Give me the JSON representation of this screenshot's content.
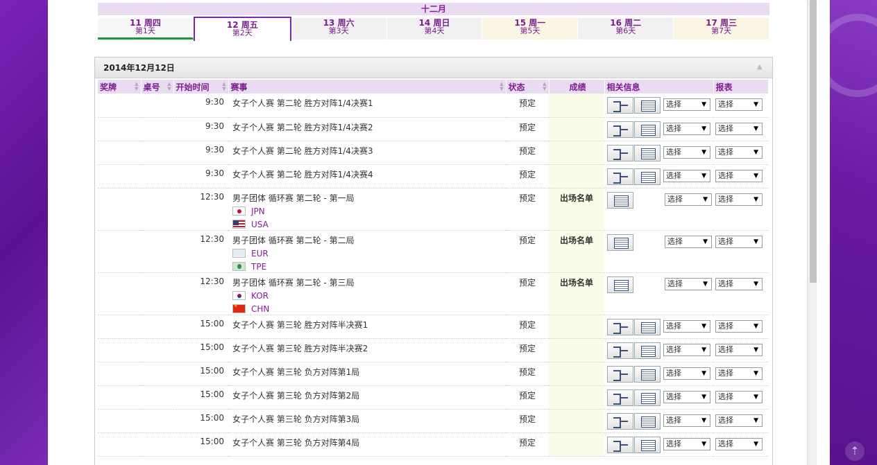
{
  "month": "十二月",
  "days": [
    {
      "d1": "11 周四",
      "d2": "第1天",
      "state": "past"
    },
    {
      "d1": "12 周五",
      "d2": "第2天",
      "state": "active"
    },
    {
      "d1": "13 周六",
      "d2": "第3天",
      "state": "normal"
    },
    {
      "d1": "14 周日",
      "d2": "第4天",
      "state": "normal"
    },
    {
      "d1": "15 周一",
      "d2": "第5天",
      "state": "weekend"
    },
    {
      "d1": "16 周二",
      "d2": "第6天",
      "state": "normal"
    },
    {
      "d1": "17 周三",
      "d2": "第7天",
      "state": "weekend"
    }
  ],
  "panel_title": "2014年12月12日",
  "columns": {
    "medal": "奖牌",
    "table": "桌号",
    "start": "开始时间",
    "event": "赛事",
    "status": "状态",
    "result": "成绩",
    "info": "相关信息",
    "report": "报表"
  },
  "select_label": "选择",
  "rows": [
    {
      "time": "9:30",
      "event": "女子个人赛 第二轮 胜方对阵1/4决赛1",
      "status": "预定",
      "result": "",
      "bracket": true,
      "teams": []
    },
    {
      "time": "9:30",
      "event": "女子个人赛 第二轮 胜方对阵1/4决赛2",
      "status": "预定",
      "result": "",
      "bracket": true,
      "teams": []
    },
    {
      "time": "9:30",
      "event": "女子个人赛 第二轮 胜方对阵1/4决赛3",
      "status": "预定",
      "result": "",
      "bracket": true,
      "teams": []
    },
    {
      "time": "9:30",
      "event": "女子个人赛 第二轮 胜方对阵1/4决赛4",
      "status": "预定",
      "result": "",
      "bracket": true,
      "teams": []
    },
    {
      "time": "12:30",
      "event": "男子团体 循环赛 第二轮 - 第一局",
      "status": "预定",
      "result": "出场名单",
      "bracket": false,
      "teams": [
        {
          "code": "JPN",
          "flag": "jpn"
        },
        {
          "code": "USA",
          "flag": "usa"
        }
      ]
    },
    {
      "time": "12:30",
      "event": "男子团体 循环赛 第二轮 - 第二局",
      "status": "预定",
      "result": "出场名单",
      "bracket": false,
      "teams": [
        {
          "code": "EUR",
          "flag": "eur"
        },
        {
          "code": "TPE",
          "flag": "tpe"
        }
      ]
    },
    {
      "time": "12:30",
      "event": "男子团体 循环赛 第二轮 - 第三局",
      "status": "预定",
      "result": "出场名单",
      "bracket": false,
      "teams": [
        {
          "code": "KOR",
          "flag": "kor"
        },
        {
          "code": "CHN",
          "flag": "chn"
        }
      ]
    },
    {
      "time": "15:00",
      "event": "女子个人赛 第三轮 胜方对阵半决赛1",
      "status": "预定",
      "result": "",
      "bracket": true,
      "teams": []
    },
    {
      "time": "15:00",
      "event": "女子个人赛 第三轮 胜方对阵半决赛2",
      "status": "预定",
      "result": "",
      "bracket": true,
      "teams": []
    },
    {
      "time": "15:00",
      "event": "女子个人赛 第三轮 负方对阵第1局",
      "status": "预定",
      "result": "",
      "bracket": true,
      "teams": []
    },
    {
      "time": "15:00",
      "event": "女子个人赛 第三轮 负方对阵第2局",
      "status": "预定",
      "result": "",
      "bracket": true,
      "teams": []
    },
    {
      "time": "15:00",
      "event": "女子个人赛 第三轮 负方对阵第3局",
      "status": "预定",
      "result": "",
      "bracket": true,
      "teams": []
    },
    {
      "time": "15:00",
      "event": "女子个人赛 第三轮 负方对阵第4局",
      "status": "预定",
      "result": "",
      "bracket": true,
      "teams": []
    }
  ],
  "icons": {
    "collapse": "collapse-up-icon",
    "bracket": "bracket-icon",
    "document": "document-icon",
    "dropdown": "chevron-down-icon"
  },
  "colors": {
    "brand_purple": "#6a1aa3",
    "accent_text": "#7a1e8e",
    "header_bg": "#eadcf0",
    "result_bg": "#fbfbe9",
    "past_day_underline": "#1f9a3a"
  }
}
